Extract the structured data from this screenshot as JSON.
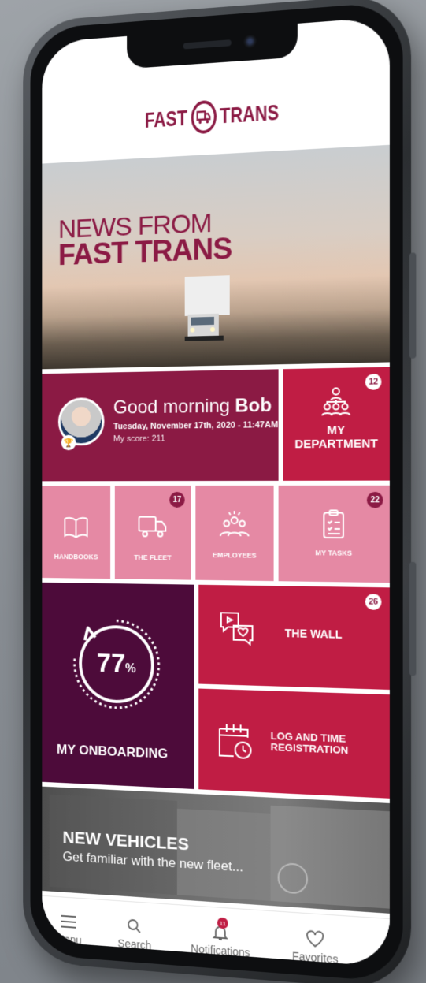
{
  "brand": {
    "left": "FAST",
    "right": "TRANS",
    "color": "#8b1a44"
  },
  "hero": {
    "line1": "NEWS FROM",
    "line2": "FAST TRANS"
  },
  "greeting": {
    "prefix": "Good morning",
    "name": "Bob",
    "date": "Tuesday, November 17th, 2020 - 11:47AM",
    "score": "My score: 211"
  },
  "department": {
    "label_line1": "MY",
    "label_line2": "DEPARTMENT",
    "badge": "12",
    "icon": "people-org-icon"
  },
  "tiles": [
    {
      "label": "HANDBOOKS",
      "icon": "book-icon",
      "badge": ""
    },
    {
      "label": "THE FLEET",
      "icon": "truck-icon",
      "badge": "17"
    },
    {
      "label": "EMPLOYEES",
      "icon": "employees-icon",
      "badge": ""
    },
    {
      "label": "MY TASKS",
      "icon": "clipboard-icon",
      "badge": "22"
    }
  ],
  "onboarding": {
    "label": "MY ONBOARDING",
    "progress": 77,
    "value": "77",
    "unit": "%"
  },
  "wall": {
    "label": "THE WALL",
    "badge": "26",
    "icon": "chat-heart-icon"
  },
  "log": {
    "label_line1": "LOG AND TIME",
    "label_line2": "REGISTRATION",
    "icon": "calendar-clock-icon"
  },
  "vehicles": {
    "title": "NEW VEHICLES",
    "subtitle": "Get familiar with the new fleet..."
  },
  "tabbar": [
    {
      "label": "Menu",
      "icon": "hamburger-icon"
    },
    {
      "label": "Search",
      "icon": "search-icon"
    },
    {
      "label": "Notifications",
      "icon": "bell-icon",
      "badge": "11"
    },
    {
      "label": "Favorites",
      "icon": "heart-icon"
    }
  ],
  "colors": {
    "primary": "#8b1a44",
    "accent": "#c01d44",
    "pink": "#e589a4",
    "dark": "#4d0b3a"
  }
}
